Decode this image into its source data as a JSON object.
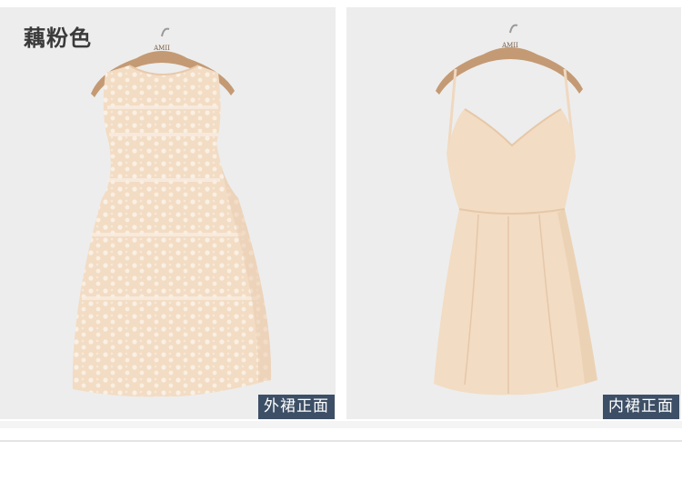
{
  "color_name": "藕粉色",
  "left_photo": {
    "caption": "外裙正面",
    "hanger_brand": "AMII",
    "item": "outer-lace-dress-icon"
  },
  "right_photo": {
    "caption": "内裙正面",
    "hanger_brand": "AMII",
    "item": "inner-slip-dress-icon"
  },
  "colors": {
    "background": "#ededed",
    "dress": "#f3dcc4",
    "caption_bg": "#3d4f66",
    "hanger": "#c49a74"
  }
}
